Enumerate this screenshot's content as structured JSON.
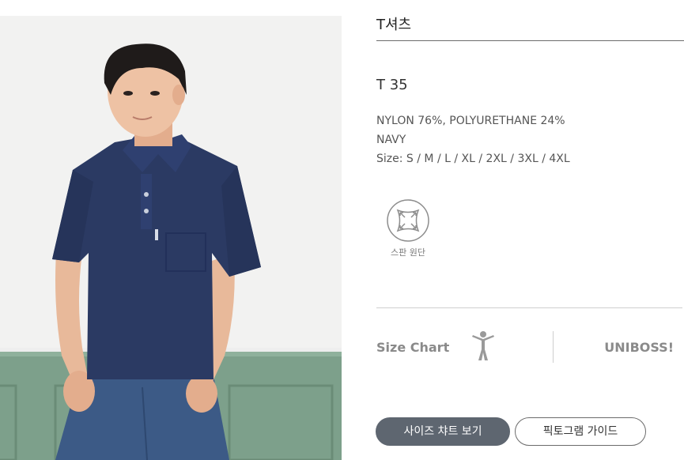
{
  "product": {
    "category": "T셔츠",
    "model": "T 35",
    "material": "NYLON 76%, POLYURETHANE 24%",
    "color": "NAVY",
    "sizes": "Size: S / M / L / XL / 2XL / 3XL / 4XL"
  },
  "feature": {
    "icon": "stretch-fabric-icon",
    "label": "스판 원단"
  },
  "size_section": {
    "label": "Size Chart",
    "icon": "person-icon",
    "brand": "UNIBOSS!"
  },
  "buttons": {
    "size_chart": "사이즈 챠트 보기",
    "pictogram": "픽토그램 가이드"
  },
  "photo": {
    "alt": "model-wearing-navy-polo-shirt"
  },
  "colors": {
    "shirt_navy": "#2b3a63",
    "wall_green": "#7da08b",
    "button_gray": "#5e6670",
    "label_gray": "#8a8a8a"
  }
}
